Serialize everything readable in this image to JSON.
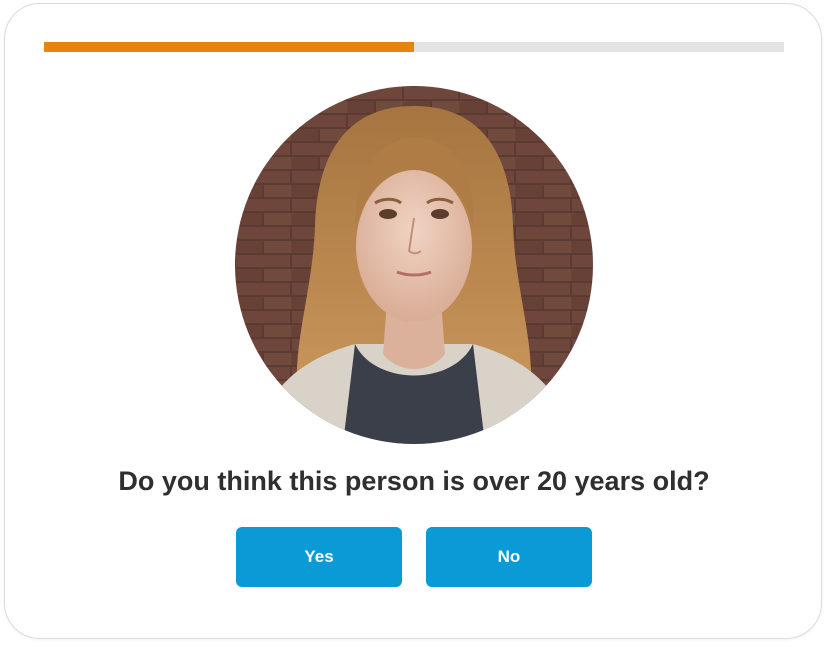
{
  "progress": {
    "fraction": 0.5,
    "fill_color": "#e5850d",
    "track_color": "#e4e4e4"
  },
  "photo": {
    "subject": "portrait of a young woman with long wavy light-brown hair in front of a brick wall"
  },
  "question": {
    "text": "Do you think this person is over 20 years old?"
  },
  "answers": {
    "yes_label": "Yes",
    "no_label": "No",
    "button_color": "#0a9bd6"
  }
}
